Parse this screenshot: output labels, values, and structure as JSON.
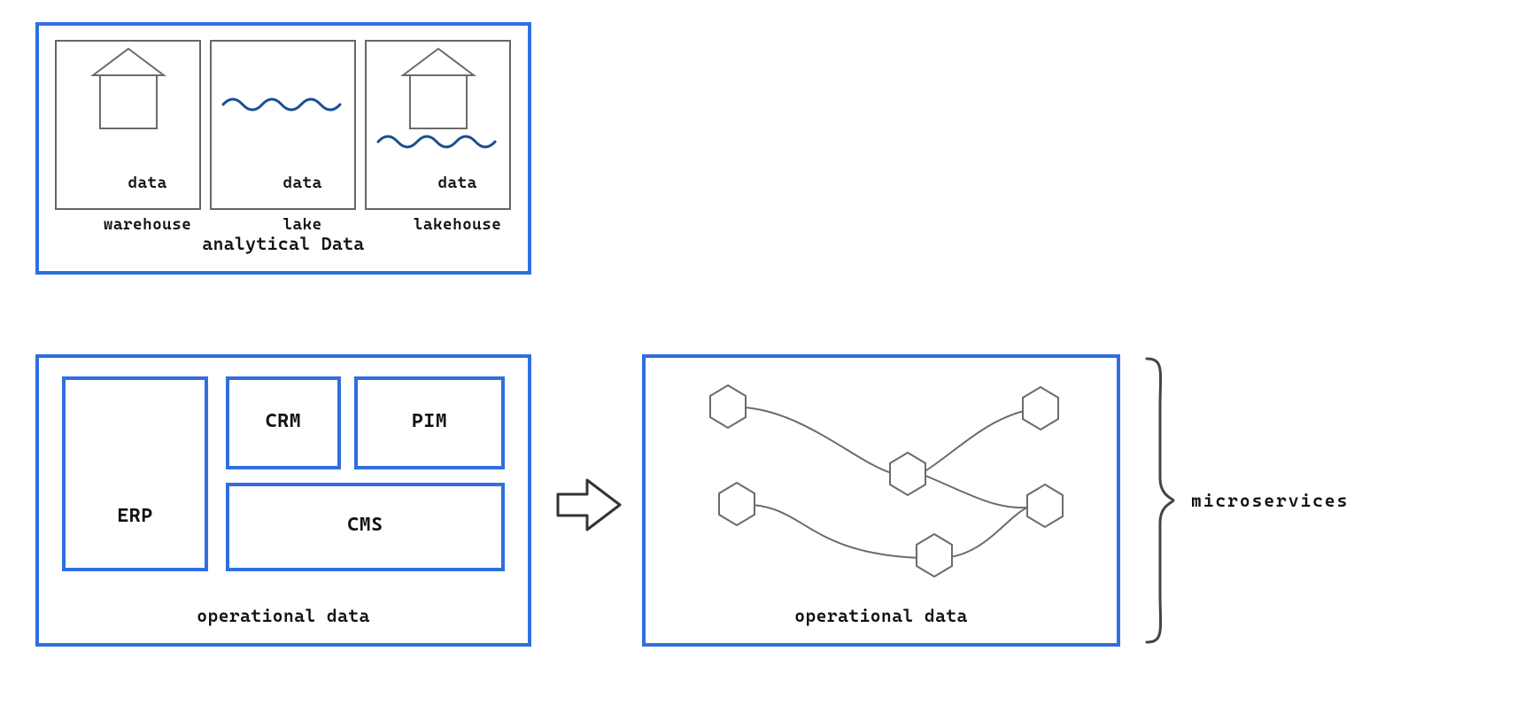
{
  "analytical": {
    "title": "analytical Data",
    "items": {
      "warehouse_line1": "data",
      "warehouse_line2": "warehouse",
      "lake_line1": "data",
      "lake_line2": "lake",
      "lakehouse_line1": "data",
      "lakehouse_line2": "lakehouse"
    }
  },
  "operational_left": {
    "title": "operational data",
    "items": {
      "erp": "ERP",
      "crm": "CRM",
      "pim": "PIM",
      "cms": "CMS"
    }
  },
  "operational_right": {
    "title": "operational data"
  },
  "microservices_label": "microservices",
  "colors": {
    "blue": "#2f6fe0",
    "wave": "#1b4f91",
    "gray": "#6b6b6b"
  }
}
